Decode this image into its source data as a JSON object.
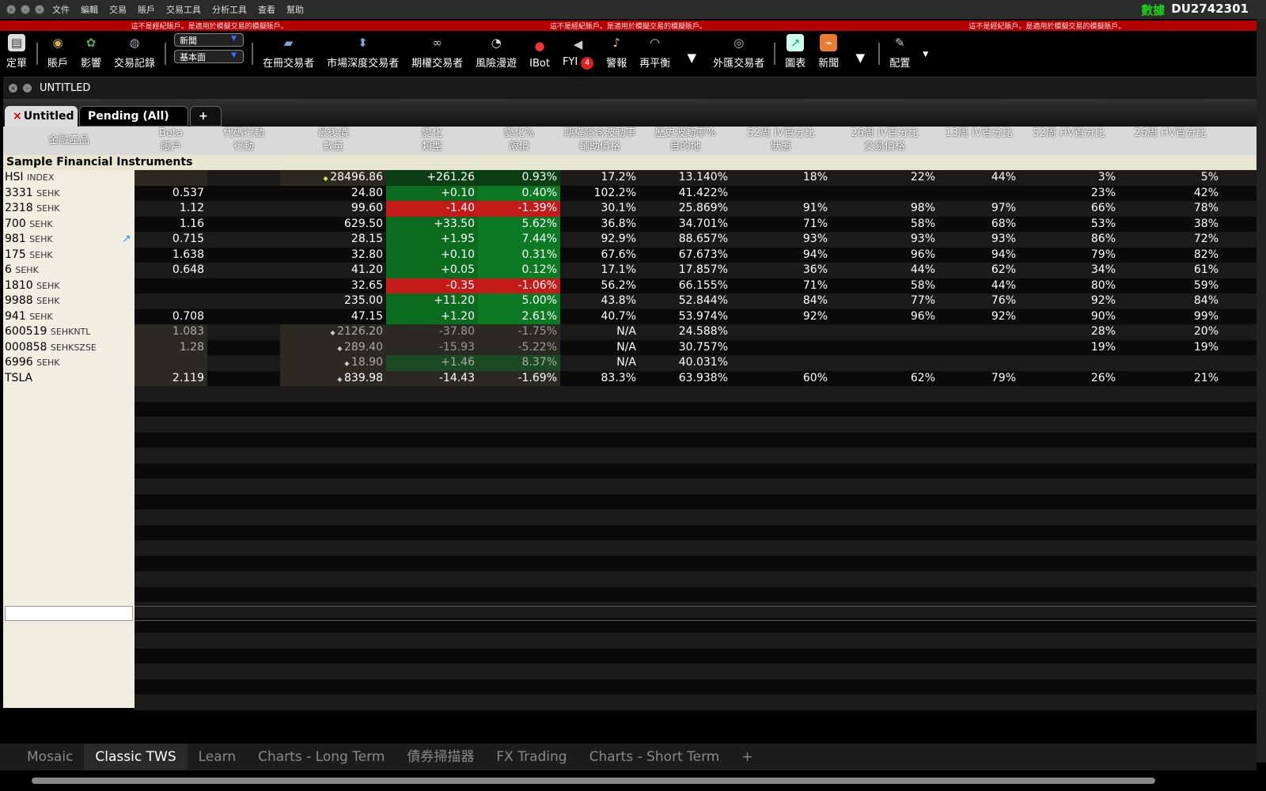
{
  "menubar": {
    "items": [
      "文件",
      "編輯",
      "交易",
      "賬戶",
      "交易工具",
      "分析工具",
      "查看",
      "幫助"
    ],
    "data_label": "數據",
    "account": "DU2742301"
  },
  "banner": {
    "text": "這不是經紀賬戶。是適用於模擬交易的模擬賬戶。"
  },
  "toolbar": {
    "order": "定單",
    "account": "賬戶",
    "impact": "影響",
    "trade_log": "交易記錄",
    "news_dd": "新聞",
    "fund_dd": "基本面",
    "book_trader": "在冊交易者",
    "depth_trader": "市場深度交易者",
    "option_trader": "期權交易者",
    "risk": "風險漫遊",
    "ibot": "IBot",
    "fyi": "FYI",
    "fyi_count": "4",
    "alert": "警報",
    "rebalance": "再平衡",
    "fx_trader": "外匯交易者",
    "charts": "圖表",
    "news": "新聞",
    "config": "配置"
  },
  "window": {
    "title": "UNTITLED"
  },
  "tabs": {
    "untitled": "Untitled",
    "pending": "Pending (All)",
    "add": "+"
  },
  "columns": {
    "instrument": "金融產品",
    "beta": "Beta",
    "account": "賬戶",
    "sym_action": "代碼行動",
    "action": "行動",
    "last": "最後價",
    "qty": "數量",
    "change": "變化",
    "type": "類型",
    "change_pct": "變化%",
    "limit": "限價",
    "opt_iv": "期權隱含波動率",
    "aux": "輔助價格",
    "hist_vol": "歷史波動率%",
    "dest": "目的地",
    "iv52": "52周 IV百分比",
    "status": "狀態",
    "iv26": "26周 IV百分比",
    "trade_price": "交易價格",
    "iv13": "13周 IV百分比",
    "hv52": "52周 HV百分比",
    "hv26": "26周 HV百分比"
  },
  "group": "Sample Financial Instruments",
  "rows": [
    {
      "sym": "HSI",
      "ex": "INDEX",
      "beta": "",
      "last": "28496.86",
      "chg": "+261.26",
      "pct": "0.93%",
      "iv": "17.2%",
      "hv": "13.140%",
      "iv52": "18%",
      "iv26": "22%",
      "iv13": "44%",
      "hv52": "3%",
      "hv26": "5%",
      "dir": "flat"
    },
    {
      "sym": "3331",
      "ex": "SEHK",
      "beta": "0.537",
      "last": "24.80",
      "chg": "+0.10",
      "pct": "0.40%",
      "iv": "102.2%",
      "hv": "41.422%",
      "iv52": "",
      "iv26": "",
      "iv13": "",
      "hv52": "23%",
      "hv26": "42%",
      "dir": "pos"
    },
    {
      "sym": "2318",
      "ex": "SEHK",
      "beta": "1.12",
      "last": "99.60",
      "chg": "-1.40",
      "pct": "-1.39%",
      "iv": "30.1%",
      "hv": "25.869%",
      "iv52": "91%",
      "iv26": "98%",
      "iv13": "97%",
      "hv52": "66%",
      "hv26": "78%",
      "dir": "neg"
    },
    {
      "sym": "700",
      "ex": "SEHK",
      "beta": "1.16",
      "last": "629.50",
      "chg": "+33.50",
      "pct": "5.62%",
      "iv": "36.8%",
      "hv": "34.701%",
      "iv52": "71%",
      "iv26": "58%",
      "iv13": "68%",
      "hv52": "53%",
      "hv26": "38%",
      "dir": "pos"
    },
    {
      "sym": "981",
      "ex": "SEHK",
      "beta": "0.715",
      "last": "28.15",
      "chg": "+1.95",
      "pct": "7.44%",
      "iv": "92.9%",
      "hv": "88.657%",
      "iv52": "93%",
      "iv26": "93%",
      "iv13": "93%",
      "hv52": "86%",
      "hv26": "72%",
      "dir": "pos"
    },
    {
      "sym": "175",
      "ex": "SEHK",
      "beta": "1.638",
      "last": "32.80",
      "chg": "+0.10",
      "pct": "0.31%",
      "iv": "67.6%",
      "hv": "67.673%",
      "iv52": "94%",
      "iv26": "96%",
      "iv13": "94%",
      "hv52": "79%",
      "hv26": "82%",
      "dir": "pos"
    },
    {
      "sym": "6",
      "ex": "SEHK",
      "beta": "0.648",
      "last": "41.20",
      "chg": "+0.05",
      "pct": "0.12%",
      "iv": "17.1%",
      "hv": "17.857%",
      "iv52": "36%",
      "iv26": "44%",
      "iv13": "62%",
      "hv52": "34%",
      "hv26": "61%",
      "dir": "pos"
    },
    {
      "sym": "1810",
      "ex": "SEHK",
      "beta": "",
      "last": "32.65",
      "chg": "-0.35",
      "pct": "-1.06%",
      "iv": "56.2%",
      "hv": "66.155%",
      "iv52": "71%",
      "iv26": "58%",
      "iv13": "44%",
      "hv52": "80%",
      "hv26": "59%",
      "dir": "neg"
    },
    {
      "sym": "9988",
      "ex": "SEHK",
      "beta": "",
      "last": "235.00",
      "chg": "+11.20",
      "pct": "5.00%",
      "iv": "43.8%",
      "hv": "52.844%",
      "iv52": "84%",
      "iv26": "77%",
      "iv13": "76%",
      "hv52": "92%",
      "hv26": "84%",
      "dir": "pos"
    },
    {
      "sym": "941",
      "ex": "SEHK",
      "beta": "0.708",
      "last": "47.15",
      "chg": "+1.20",
      "pct": "2.61%",
      "iv": "40.7%",
      "hv": "53.974%",
      "iv52": "92%",
      "iv26": "96%",
      "iv13": "92%",
      "hv52": "90%",
      "hv26": "99%",
      "dir": "pos"
    },
    {
      "sym": "600519",
      "ex": "SEHKNTL",
      "beta": "1.083",
      "last": "2126.20",
      "chg": "-37.80",
      "pct": "-1.75%",
      "iv": "N/A",
      "hv": "24.588%",
      "iv52": "",
      "iv26": "",
      "iv13": "",
      "hv52": "28%",
      "hv26": "20%",
      "dir": "dim"
    },
    {
      "sym": "000858",
      "ex": "SEHKSZSE",
      "beta": "1.28",
      "last": "289.40",
      "chg": "-15.93",
      "pct": "-5.22%",
      "iv": "N/A",
      "hv": "30.757%",
      "iv52": "",
      "iv26": "",
      "iv13": "",
      "hv52": "19%",
      "hv26": "19%",
      "dir": "dim"
    },
    {
      "sym": "6996",
      "ex": "SEHK",
      "beta": "",
      "last": "18.90",
      "chg": "+1.46",
      "pct": "8.37%",
      "iv": "N/A",
      "hv": "40.031%",
      "iv52": "",
      "iv26": "",
      "iv13": "",
      "hv52": "",
      "hv26": "",
      "dir": "dimpos"
    },
    {
      "sym": "TSLA",
      "ex": "",
      "beta": "2.119",
      "last": "839.98",
      "chg": "-14.43",
      "pct": "-1.69%",
      "iv": "83.3%",
      "hv": "63.938%",
      "iv52": "60%",
      "iv26": "62%",
      "iv13": "79%",
      "hv52": "26%",
      "hv26": "21%",
      "dir": "dimneg"
    }
  ],
  "bottom_tabs": [
    "Mosaic",
    "Classic TWS",
    "Learn",
    "Charts - Long Term",
    "債券掃描器",
    "FX Trading",
    "Charts - Short Term",
    "+"
  ],
  "colors": {
    "positive": "#0b6b1e",
    "negative": "#c51a1a",
    "banner": "#b40000",
    "data_label": "#19d219"
  }
}
